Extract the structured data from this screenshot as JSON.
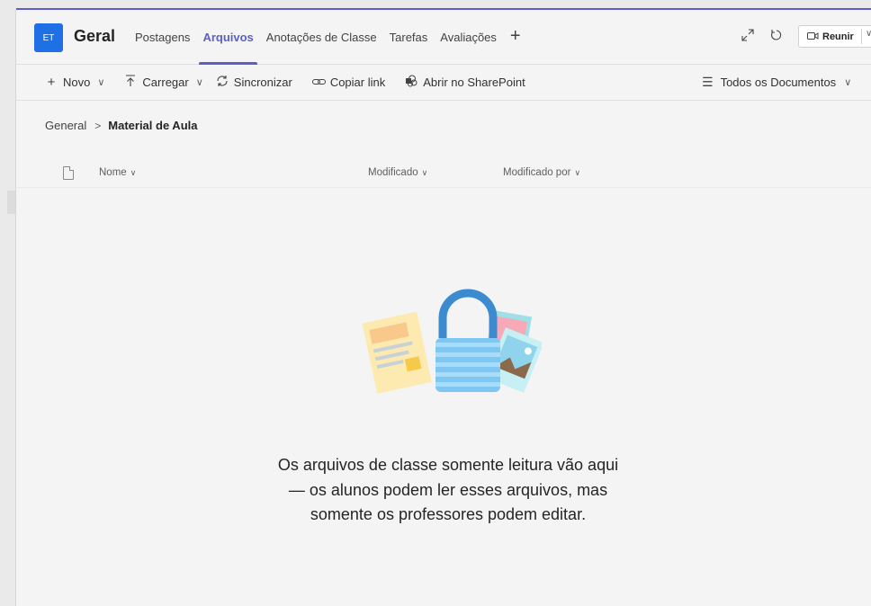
{
  "header": {
    "team_initials": "ET",
    "channel_name": "Geral",
    "tabs": [
      {
        "label": "Postagens"
      },
      {
        "label": "Arquivos",
        "active": true
      },
      {
        "label": "Anotações de Classe"
      },
      {
        "label": "Tarefas"
      },
      {
        "label": "Avaliações"
      }
    ],
    "add_tab_icon": "plus-icon",
    "meet_label": "Reunir"
  },
  "toolbar": {
    "new_label": "Novo",
    "upload_label": "Carregar",
    "sync_label": "Sincronizar",
    "copy_link_label": "Copiar link",
    "sharepoint_label": "Abrir no SharePoint",
    "view_label": "Todos os Documentos"
  },
  "breadcrumb": {
    "root": "General",
    "current": "Material de Aula"
  },
  "columns": {
    "name": "Nome",
    "modified": "Modificado",
    "modified_by": "Modificado por"
  },
  "empty_state": {
    "message": "Os arquivos de classe somente leitura vão aqui — os alunos podem ler esses arquivos, mas somente os professores podem editar."
  },
  "colors": {
    "accent": "#5b5fc7",
    "team_avatar": "#1f6fe5",
    "background": "#f5f4f4"
  }
}
